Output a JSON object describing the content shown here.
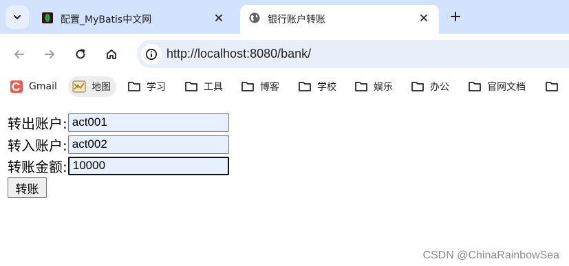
{
  "tabs": [
    {
      "title": "配置_MyBatis中文网",
      "active": false,
      "icon": "mybatis-favicon"
    },
    {
      "title": "银行账户转账",
      "active": true,
      "icon": "globe-icon"
    }
  ],
  "address_bar": {
    "url": "http://localhost:8080/bank/"
  },
  "bookmarks": [
    {
      "label": "Gmail",
      "icon": "gmail-icon"
    },
    {
      "label": "地图",
      "icon": "maps-icon"
    },
    {
      "label": "学习",
      "icon": "folder-icon"
    },
    {
      "label": "工具",
      "icon": "folder-icon"
    },
    {
      "label": "博客",
      "icon": "folder-icon"
    },
    {
      "label": "学校",
      "icon": "folder-icon"
    },
    {
      "label": "娱乐",
      "icon": "folder-icon"
    },
    {
      "label": "办公",
      "icon": "folder-icon"
    },
    {
      "label": "官网文档",
      "icon": "folder-icon"
    }
  ],
  "form": {
    "from_label": "转出账户:",
    "from_value": "act001",
    "to_label": "转入账户:",
    "to_value": "act002",
    "amount_label": "转账金额:",
    "amount_value": "10000",
    "submit_label": "转账"
  },
  "watermark": "CSDN @ChinaRainbowSea",
  "colors": {
    "tabstrip": "#d3e3fd",
    "omnibox": "#e9eefb",
    "autofill": "#e8f0fe"
  }
}
